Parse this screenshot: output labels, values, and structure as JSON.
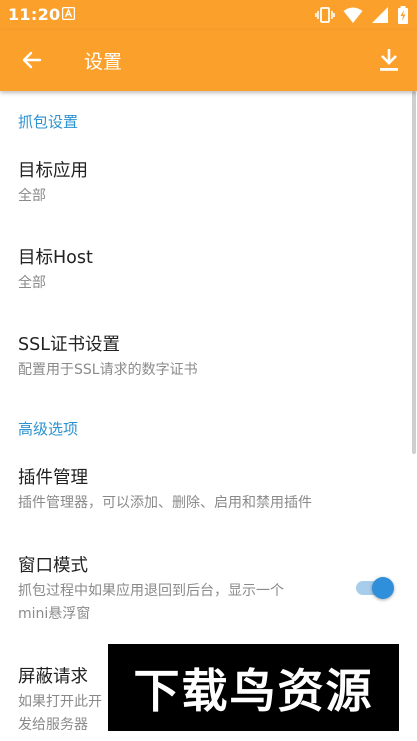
{
  "status_bar": {
    "time": "11:20",
    "icons": [
      "notification-a-icon",
      "vibrate-icon",
      "wifi-icon",
      "signal-icon",
      "battery-icon"
    ]
  },
  "toolbar": {
    "title": "设置",
    "back_icon": "arrow-left-icon",
    "action_icon": "download-icon",
    "background_color": "#fba12b"
  },
  "sections": [
    {
      "header": "抓包设置",
      "items": [
        {
          "title": "目标应用",
          "summary": "全部"
        },
        {
          "title": "目标Host",
          "summary": "全部"
        },
        {
          "title": "SSL证书设置",
          "summary": "配置用于SSL请求的数字证书"
        }
      ]
    },
    {
      "header": "高级选项",
      "items": [
        {
          "title": "插件管理",
          "summary": "插件管理器，可以添加、删除、启用和禁用插件"
        },
        {
          "title": "窗口模式",
          "summary_line1": "抓包过程中如果应用退回到后台，显示一个",
          "summary_line2": "mini悬浮窗",
          "switch_on": true
        },
        {
          "title": "屏蔽请求",
          "summary_line1": "如果打开此开",
          "summary_line2": "发给服务器"
        }
      ]
    }
  ],
  "watermark": {
    "text": "下载鸟资源"
  },
  "colors": {
    "accent": "#2c93d0",
    "switch_thumb": "#2f8fdb",
    "switch_track": "#a8cdea"
  }
}
